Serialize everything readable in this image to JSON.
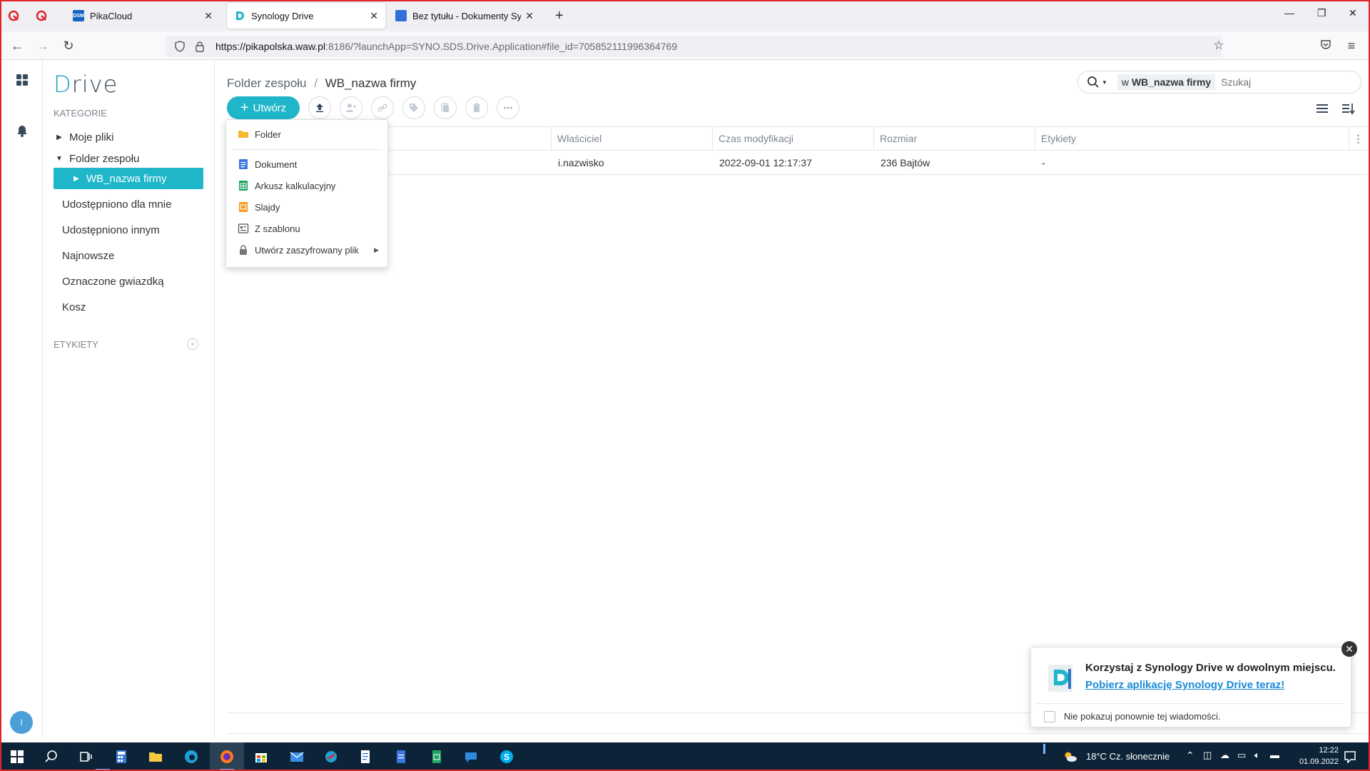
{
  "browser": {
    "tabs": [
      {
        "title": "PikaCloud",
        "favicon": "dsm-icon"
      },
      {
        "title": "Synology Drive",
        "favicon": "synology-drive-icon",
        "active": true
      },
      {
        "title": "Bez tytułu - Dokumenty Synolo",
        "favicon": "document-icon"
      }
    ],
    "url_host": "https://pikapolska.waw.pl",
    "url_rest": ":8186/?launchApp=SYNO.SDS.Drive.Application#file_id=705852111996364769",
    "favicon_dsm_text": "DSM"
  },
  "sidebar": {
    "logo_first": "D",
    "logo_rest": "rive",
    "categories_heading": "KATEGORIE",
    "items": [
      {
        "label": "Moje pliki"
      },
      {
        "label": "Folder zespołu"
      },
      {
        "label": "WB_nazwa firmy"
      },
      {
        "label": "Udostępniono dla mnie"
      },
      {
        "label": "Udostępniono innym"
      },
      {
        "label": "Najnowsze"
      },
      {
        "label": "Oznaczone gwiazdką"
      },
      {
        "label": "Kosz"
      }
    ],
    "labels_heading": "ETYKIETY",
    "avatar_initial": "I"
  },
  "main": {
    "breadcrumb": {
      "parent": "Folder zespołu",
      "separator": "/",
      "current": "WB_nazwa firmy"
    },
    "search": {
      "scope_prefix": "w",
      "scope_name": "WB_nazwa firmy",
      "placeholder": "Szukaj"
    },
    "create_label": "Utwórz",
    "columns": [
      "Właściciel",
      "Czas modyfikacji",
      "Rozmiar",
      "Etykiety"
    ],
    "rows": [
      {
        "owner": "i.nazwisko",
        "modified": "2022-09-01 12:17:37",
        "size": "236 Bajtów",
        "labels": "-"
      }
    ]
  },
  "create_menu": {
    "items": [
      {
        "label": "Folder",
        "icon": "folder-icon"
      },
      {
        "label": "Dokument",
        "icon": "document-icon"
      },
      {
        "label": "Arkusz kalkulacyjny",
        "icon": "spreadsheet-icon"
      },
      {
        "label": "Slajdy",
        "icon": "slides-icon"
      },
      {
        "label": "Z szablonu",
        "icon": "template-icon"
      },
      {
        "label": "Utwórz zaszyfrowany plik",
        "icon": "lock-icon"
      }
    ]
  },
  "notification": {
    "title": "Korzystaj z Synology Drive w dowolnym miejscu.",
    "link": "Pobierz aplikację Synology Drive teraz!",
    "checkbox_label": "Nie pokazuj ponownie tej wiadomości."
  },
  "taskbar": {
    "weather": "18°C  Cz. słonecznie",
    "time": "12:22",
    "date": "01.09.2022"
  },
  "colors": {
    "accent": "#1fb6c9",
    "link": "#1a8ad8",
    "frame": "#e0242a",
    "taskbar": "#0d2438"
  }
}
